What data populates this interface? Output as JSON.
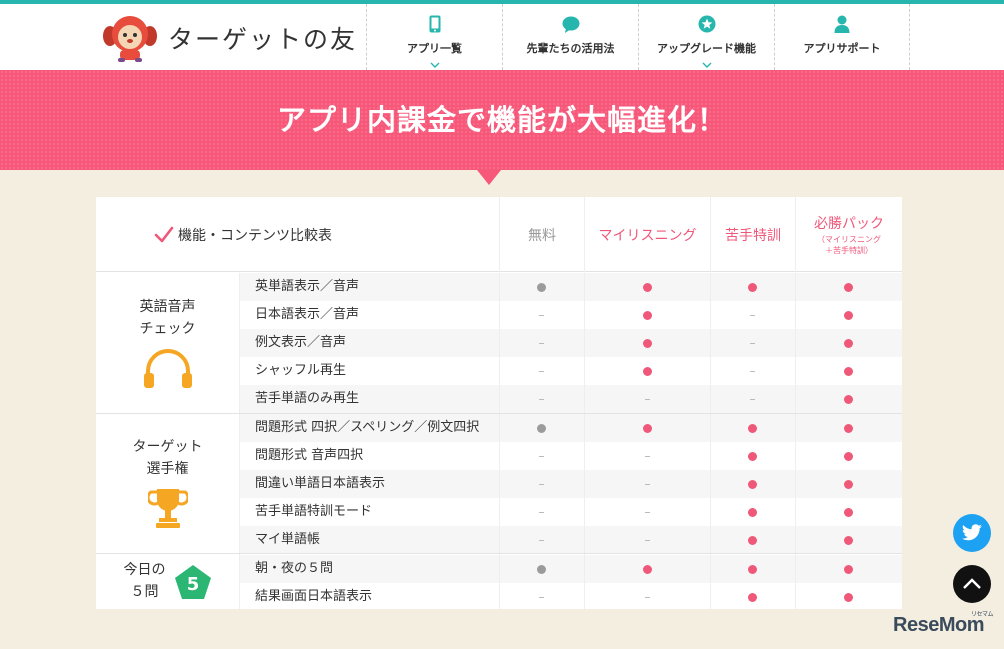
{
  "header": {
    "logo_text": "ターゲットの友",
    "nav": [
      {
        "label": "アプリ一覧",
        "icon": "smartphone-icon",
        "has_dropdown": true
      },
      {
        "label": "先輩たちの活用法",
        "icon": "speech-bubble-icon",
        "has_dropdown": false
      },
      {
        "label": "アップグレード機能",
        "icon": "star-badge-icon",
        "has_dropdown": true
      },
      {
        "label": "アプリサポート",
        "icon": "person-icon",
        "has_dropdown": false
      }
    ],
    "accent_color": "#27b6ae"
  },
  "banner": {
    "title": "アプリ内課金で機能が大幅進化！",
    "color": "#f7587a"
  },
  "table": {
    "feature_header": "機能・コンテンツ比較表",
    "plans": [
      {
        "name": "無料",
        "sub": ""
      },
      {
        "name": "マイリスニング",
        "sub": ""
      },
      {
        "name": "苦手特訓",
        "sub": ""
      },
      {
        "name": "必勝パック",
        "sub1": "（マイリスニング",
        "sub2": "＋苦手特訓）"
      }
    ],
    "dash": "-",
    "groups": [
      {
        "label_lines": [
          "英語音声",
          "チェック"
        ],
        "icon": "headphones-icon",
        "rows": [
          {
            "label": "英単語表示／音声",
            "cells": [
              "gray",
              "full",
              "full",
              "full"
            ]
          },
          {
            "label": "日本語表示／音声",
            "cells": [
              "none",
              "full",
              "none",
              "full"
            ]
          },
          {
            "label": "例文表示／音声",
            "cells": [
              "none",
              "full",
              "none",
              "full"
            ]
          },
          {
            "label": "シャッフル再生",
            "cells": [
              "none",
              "full",
              "none",
              "full"
            ]
          },
          {
            "label": "苦手単語のみ再生",
            "cells": [
              "none",
              "none",
              "none",
              "full"
            ]
          }
        ]
      },
      {
        "label_lines": [
          "ターゲット",
          "選手権"
        ],
        "icon": "trophy-icon",
        "rows": [
          {
            "label": "問題形式 四択／スペリング／例文四択",
            "cells": [
              "gray",
              "full",
              "full",
              "full"
            ]
          },
          {
            "label": "問題形式 音声四択",
            "cells": [
              "none",
              "none",
              "full",
              "full"
            ]
          },
          {
            "label": "間違い単語日本語表示",
            "cells": [
              "none",
              "none",
              "full",
              "full"
            ]
          },
          {
            "label": "苦手単語特訓モード",
            "cells": [
              "none",
              "none",
              "full",
              "full"
            ]
          },
          {
            "label": "マイ単語帳",
            "cells": [
              "none",
              "none",
              "full",
              "full"
            ]
          }
        ]
      },
      {
        "label_lines": [
          "今日の",
          "５問"
        ],
        "icon": "pentagon-5-icon",
        "badge_number": "5",
        "rows": [
          {
            "label": "朝・夜の５問",
            "cells": [
              "gray",
              "full",
              "full",
              "full"
            ]
          },
          {
            "label": "結果画面日本語表示",
            "cells": [
              "none",
              "none",
              "full",
              "full"
            ]
          }
        ]
      }
    ]
  },
  "floating": {
    "twitter_icon": "twitter-bird-icon",
    "top_icon": "chevron-up-icon"
  },
  "watermark": {
    "text": "ReseMom",
    "sub": "リセマム"
  },
  "colors": {
    "pink": "#f0587a",
    "gray_dot": "#9b9b9b",
    "headphones": "#f5a623",
    "trophy": "#f5a623",
    "badge_green": "#2bb673"
  }
}
